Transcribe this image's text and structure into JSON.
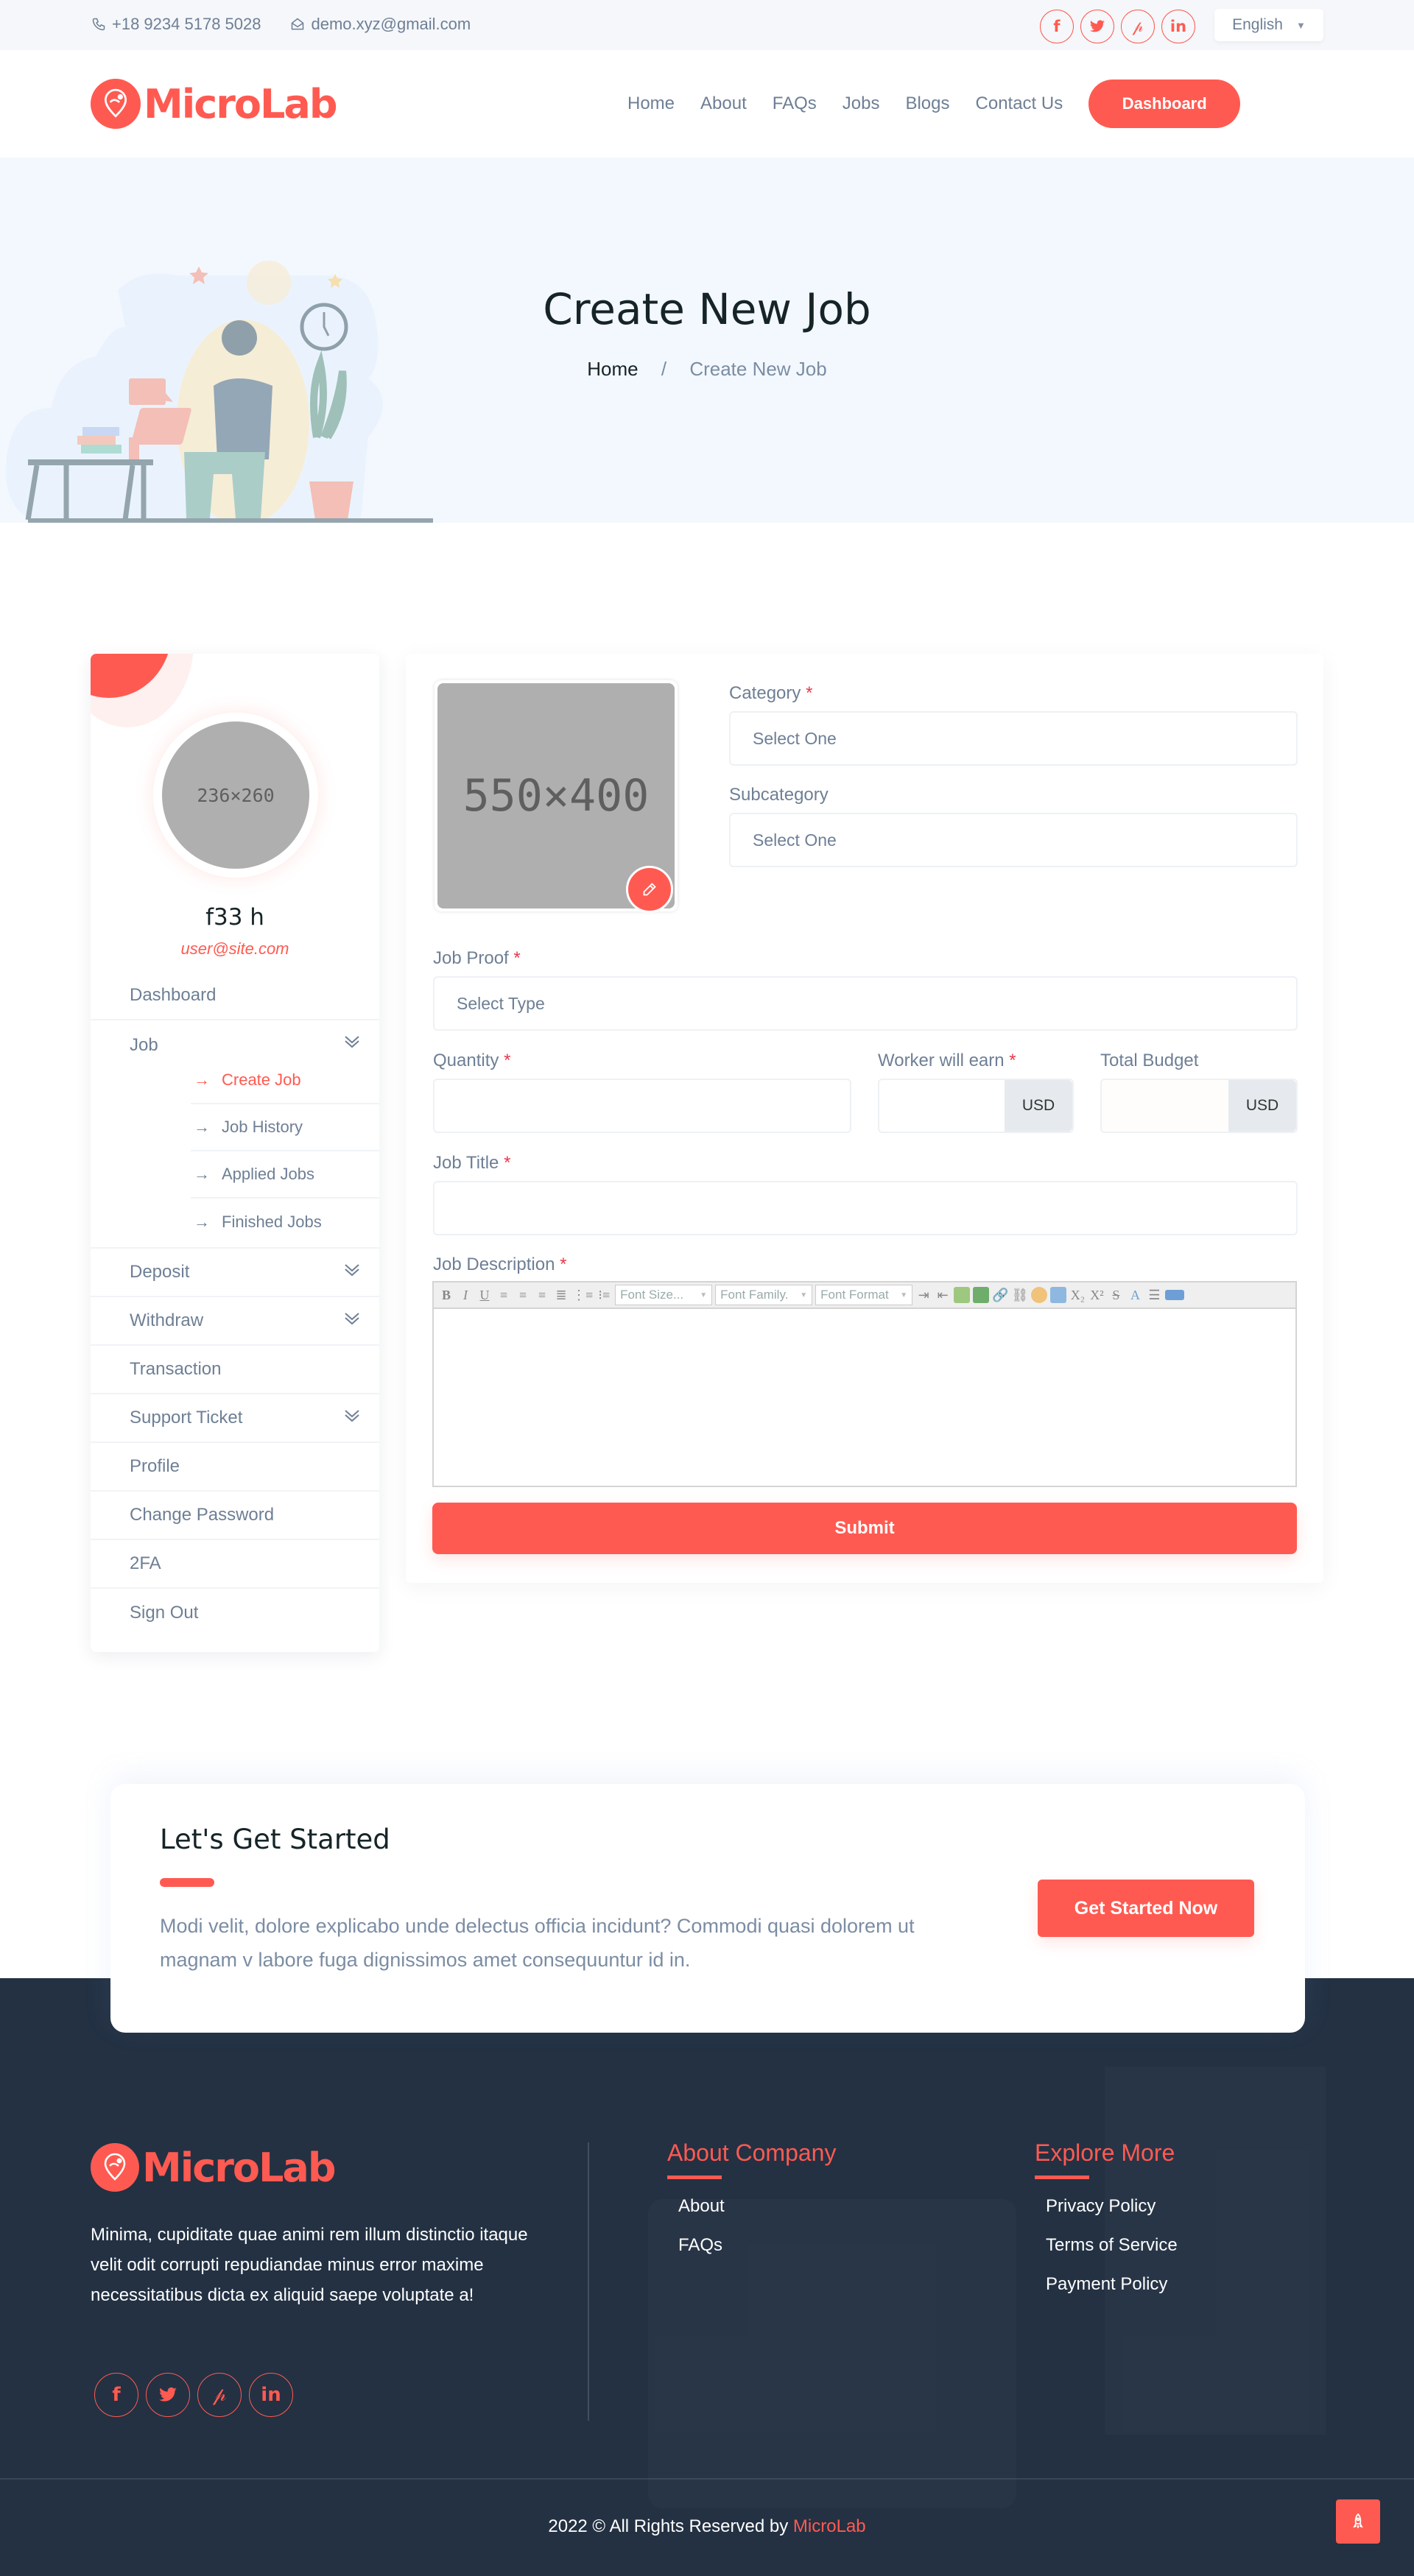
{
  "colors": {
    "accent": "#ff5a51",
    "text_muted": "#6e7f95",
    "heading": "#162428",
    "footer_bg": "#233143",
    "hero_bg": "#f3f8fe"
  },
  "topbar": {
    "phone": "+18 9234 5178 5028",
    "email": "demo.xyz@gmail.com",
    "socials": [
      {
        "icon": "facebook-icon",
        "glyph": "f"
      },
      {
        "icon": "twitter-icon",
        "glyph": "🐦"
      },
      {
        "icon": "pinterest-icon",
        "glyph": "P"
      },
      {
        "icon": "linkedin-icon",
        "glyph": "in"
      }
    ],
    "language": "English"
  },
  "header": {
    "brand": "MicroLab",
    "nav": [
      "Home",
      "About",
      "FAQs",
      "Jobs",
      "Blogs",
      "Contact Us"
    ],
    "dashboard_button": "Dashboard"
  },
  "hero": {
    "title": "Create New Job",
    "breadcrumb": {
      "home": "Home",
      "separator": "/",
      "current": "Create New Job"
    }
  },
  "sidebar": {
    "avatar_placeholder": "236×260",
    "user_name": "f33 h",
    "user_email": "user@site.com",
    "menu": [
      {
        "label": "Dashboard",
        "has_children": false
      },
      {
        "label": "Job",
        "has_children": true,
        "expanded": true,
        "children": [
          {
            "label": "Create Job",
            "active": true
          },
          {
            "label": "Job History",
            "active": false
          },
          {
            "label": "Applied Jobs",
            "active": false
          },
          {
            "label": "Finished Jobs",
            "active": false
          }
        ]
      },
      {
        "label": "Deposit",
        "has_children": true
      },
      {
        "label": "Withdraw",
        "has_children": true
      },
      {
        "label": "Transaction",
        "has_children": false
      },
      {
        "label": "Support Ticket",
        "has_children": true
      },
      {
        "label": "Profile",
        "has_children": false
      },
      {
        "label": "Change Password",
        "has_children": false
      },
      {
        "label": "2FA",
        "has_children": false
      },
      {
        "label": "Sign Out",
        "has_children": false
      }
    ],
    "arrow": "→"
  },
  "form": {
    "image_placeholder": "550×400",
    "required_mark": "*",
    "category": {
      "label": "Category",
      "value": "Select One",
      "required": true
    },
    "subcategory": {
      "label": "Subcategory",
      "value": "Select One",
      "required": false
    },
    "job_proof": {
      "label": "Job Proof",
      "value": "Select Type",
      "required": true
    },
    "quantity": {
      "label": "Quantity",
      "value": "",
      "required": true
    },
    "worker_earn": {
      "label": "Worker will earn",
      "value": "",
      "currency": "USD",
      "required": true
    },
    "total_budget": {
      "label": "Total Budget",
      "value": "",
      "currency": "USD",
      "required": false
    },
    "job_title": {
      "label": "Job Title",
      "value": "",
      "required": true
    },
    "job_description": {
      "label": "Job Description",
      "value": "",
      "required": true,
      "toolbar": {
        "font_size": "Font Size...",
        "font_family": "Font Family.",
        "font_format": "Font Format"
      }
    },
    "submit": "Submit"
  },
  "cta": {
    "title": "Let's Get Started",
    "text": "Modi velit, dolore explicabo unde delectus officia incidunt? Commodi quasi dolorem ut magnam v labore fuga dignissimos amet consequuntur id in.",
    "button": "Get Started Now"
  },
  "footer": {
    "brand": "MicroLab",
    "about": "Minima, cupiditate quae animi rem illum distinctio itaque velit odit corrupti repudiandae minus error maxime necessitatibus dicta ex aliquid saepe voluptate a!",
    "columns": [
      {
        "title": "About Company",
        "links": [
          "About",
          "FAQs"
        ]
      },
      {
        "title": "Explore More",
        "links": [
          "Privacy Policy",
          "Terms of Service",
          "Payment Policy"
        ]
      }
    ],
    "copyright_prefix": "2022 © All Rights Reserved by",
    "copyright_brand": "MicroLab"
  }
}
